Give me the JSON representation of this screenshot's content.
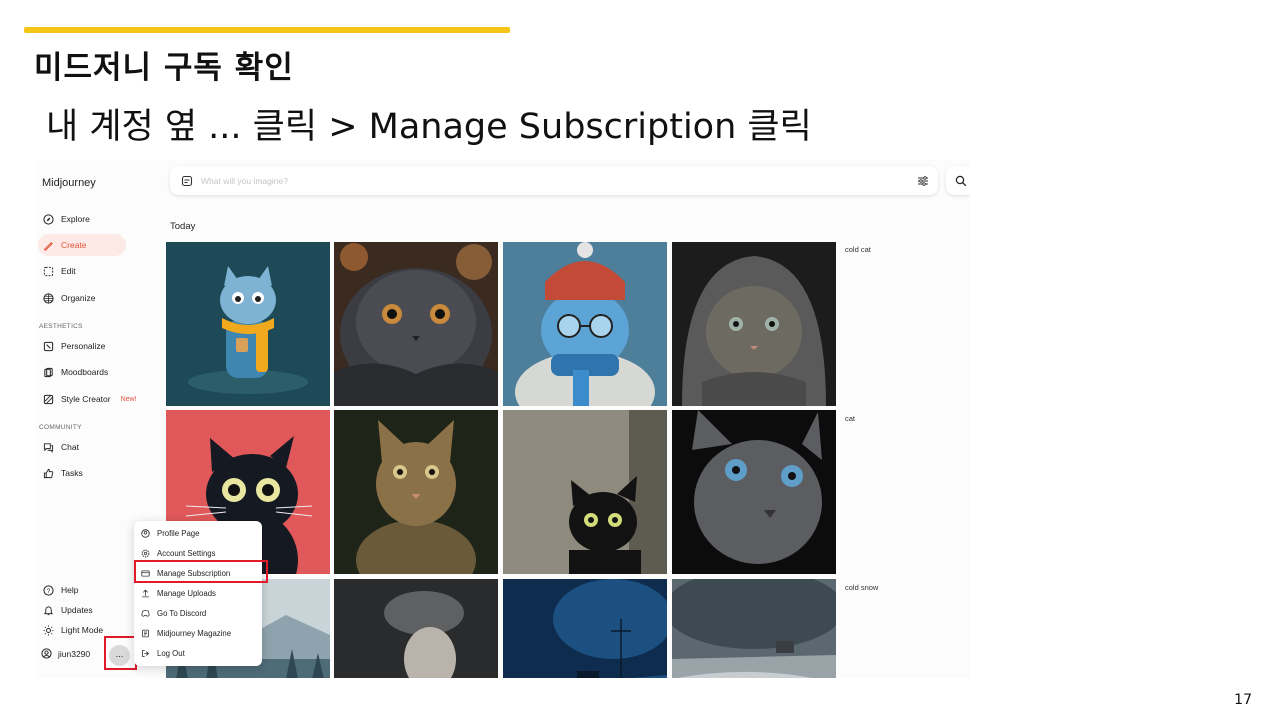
{
  "slide": {
    "title": "미드저니 구독 확인",
    "subtitle": "내 계정 옆 ... 클릭 > Manage Subscription 클릭",
    "page_number": "17",
    "accent_color": "#f5c518",
    "highlight_color": "#e0192b"
  },
  "app": {
    "brand": "Midjourney",
    "nav": [
      {
        "label": "Explore",
        "icon": "compass-icon"
      },
      {
        "label": "Create",
        "icon": "brush-icon",
        "active": true
      },
      {
        "label": "Edit",
        "icon": "edit-icon"
      },
      {
        "label": "Organize",
        "icon": "grid-icon"
      }
    ],
    "aesthetics_label": "AESTHETICS",
    "aesthetics": [
      {
        "label": "Personalize",
        "icon": "personalize-icon"
      },
      {
        "label": "Moodboards",
        "icon": "moodboard-icon"
      },
      {
        "label": "Style Creator",
        "icon": "style-icon",
        "badge": "New!"
      }
    ],
    "community_label": "COMMUNITY",
    "community": [
      {
        "label": "Chat",
        "icon": "chat-icon"
      },
      {
        "label": "Tasks",
        "icon": "thumbs-up-icon"
      }
    ],
    "bottom": [
      {
        "label": "Help",
        "icon": "help-icon"
      },
      {
        "label": "Updates",
        "icon": "bell-icon"
      },
      {
        "label": "Light Mode",
        "icon": "sun-icon"
      }
    ],
    "user": {
      "name": "jiun3290",
      "more_label": "..."
    },
    "search": {
      "placeholder": "What will you imagine?"
    },
    "today_label": "Today",
    "rows": [
      {
        "prompt": "cold cat"
      },
      {
        "prompt": "cat"
      },
      {
        "prompt": "cold snow"
      }
    ],
    "menu": [
      {
        "label": "Profile Page",
        "icon": "profile-icon"
      },
      {
        "label": "Account Settings",
        "icon": "settings-icon"
      },
      {
        "label": "Manage Subscription",
        "icon": "card-icon",
        "highlighted": true
      },
      {
        "label": "Manage Uploads",
        "icon": "upload-icon"
      },
      {
        "label": "Go To Discord",
        "icon": "discord-icon"
      },
      {
        "label": "Midjourney Magazine",
        "icon": "magazine-icon"
      },
      {
        "label": "Log Out",
        "icon": "logout-icon"
      }
    ]
  }
}
